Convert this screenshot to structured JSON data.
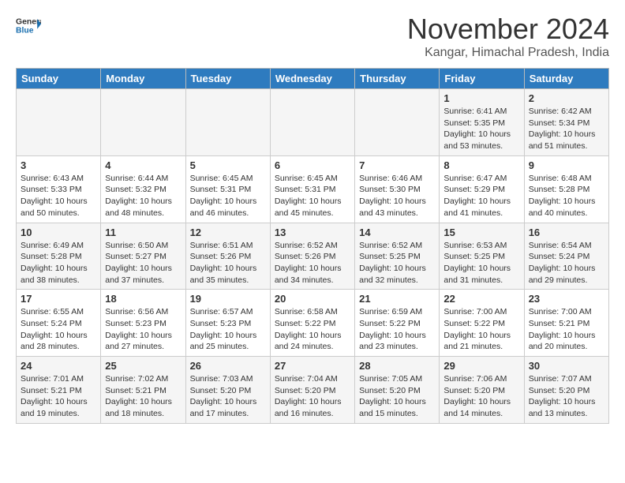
{
  "header": {
    "logo_general": "General",
    "logo_blue": "Blue",
    "month_title": "November 2024",
    "location": "Kangar, Himachal Pradesh, India"
  },
  "columns": [
    "Sunday",
    "Monday",
    "Tuesday",
    "Wednesday",
    "Thursday",
    "Friday",
    "Saturday"
  ],
  "weeks": [
    [
      {
        "day": "",
        "info": ""
      },
      {
        "day": "",
        "info": ""
      },
      {
        "day": "",
        "info": ""
      },
      {
        "day": "",
        "info": ""
      },
      {
        "day": "",
        "info": ""
      },
      {
        "day": "1",
        "info": "Sunrise: 6:41 AM\nSunset: 5:35 PM\nDaylight: 10 hours and 53 minutes."
      },
      {
        "day": "2",
        "info": "Sunrise: 6:42 AM\nSunset: 5:34 PM\nDaylight: 10 hours and 51 minutes."
      }
    ],
    [
      {
        "day": "3",
        "info": "Sunrise: 6:43 AM\nSunset: 5:33 PM\nDaylight: 10 hours and 50 minutes."
      },
      {
        "day": "4",
        "info": "Sunrise: 6:44 AM\nSunset: 5:32 PM\nDaylight: 10 hours and 48 minutes."
      },
      {
        "day": "5",
        "info": "Sunrise: 6:45 AM\nSunset: 5:31 PM\nDaylight: 10 hours and 46 minutes."
      },
      {
        "day": "6",
        "info": "Sunrise: 6:45 AM\nSunset: 5:31 PM\nDaylight: 10 hours and 45 minutes."
      },
      {
        "day": "7",
        "info": "Sunrise: 6:46 AM\nSunset: 5:30 PM\nDaylight: 10 hours and 43 minutes."
      },
      {
        "day": "8",
        "info": "Sunrise: 6:47 AM\nSunset: 5:29 PM\nDaylight: 10 hours and 41 minutes."
      },
      {
        "day": "9",
        "info": "Sunrise: 6:48 AM\nSunset: 5:28 PM\nDaylight: 10 hours and 40 minutes."
      }
    ],
    [
      {
        "day": "10",
        "info": "Sunrise: 6:49 AM\nSunset: 5:28 PM\nDaylight: 10 hours and 38 minutes."
      },
      {
        "day": "11",
        "info": "Sunrise: 6:50 AM\nSunset: 5:27 PM\nDaylight: 10 hours and 37 minutes."
      },
      {
        "day": "12",
        "info": "Sunrise: 6:51 AM\nSunset: 5:26 PM\nDaylight: 10 hours and 35 minutes."
      },
      {
        "day": "13",
        "info": "Sunrise: 6:52 AM\nSunset: 5:26 PM\nDaylight: 10 hours and 34 minutes."
      },
      {
        "day": "14",
        "info": "Sunrise: 6:52 AM\nSunset: 5:25 PM\nDaylight: 10 hours and 32 minutes."
      },
      {
        "day": "15",
        "info": "Sunrise: 6:53 AM\nSunset: 5:25 PM\nDaylight: 10 hours and 31 minutes."
      },
      {
        "day": "16",
        "info": "Sunrise: 6:54 AM\nSunset: 5:24 PM\nDaylight: 10 hours and 29 minutes."
      }
    ],
    [
      {
        "day": "17",
        "info": "Sunrise: 6:55 AM\nSunset: 5:24 PM\nDaylight: 10 hours and 28 minutes."
      },
      {
        "day": "18",
        "info": "Sunrise: 6:56 AM\nSunset: 5:23 PM\nDaylight: 10 hours and 27 minutes."
      },
      {
        "day": "19",
        "info": "Sunrise: 6:57 AM\nSunset: 5:23 PM\nDaylight: 10 hours and 25 minutes."
      },
      {
        "day": "20",
        "info": "Sunrise: 6:58 AM\nSunset: 5:22 PM\nDaylight: 10 hours and 24 minutes."
      },
      {
        "day": "21",
        "info": "Sunrise: 6:59 AM\nSunset: 5:22 PM\nDaylight: 10 hours and 23 minutes."
      },
      {
        "day": "22",
        "info": "Sunrise: 7:00 AM\nSunset: 5:22 PM\nDaylight: 10 hours and 21 minutes."
      },
      {
        "day": "23",
        "info": "Sunrise: 7:00 AM\nSunset: 5:21 PM\nDaylight: 10 hours and 20 minutes."
      }
    ],
    [
      {
        "day": "24",
        "info": "Sunrise: 7:01 AM\nSunset: 5:21 PM\nDaylight: 10 hours and 19 minutes."
      },
      {
        "day": "25",
        "info": "Sunrise: 7:02 AM\nSunset: 5:21 PM\nDaylight: 10 hours and 18 minutes."
      },
      {
        "day": "26",
        "info": "Sunrise: 7:03 AM\nSunset: 5:20 PM\nDaylight: 10 hours and 17 minutes."
      },
      {
        "day": "27",
        "info": "Sunrise: 7:04 AM\nSunset: 5:20 PM\nDaylight: 10 hours and 16 minutes."
      },
      {
        "day": "28",
        "info": "Sunrise: 7:05 AM\nSunset: 5:20 PM\nDaylight: 10 hours and 15 minutes."
      },
      {
        "day": "29",
        "info": "Sunrise: 7:06 AM\nSunset: 5:20 PM\nDaylight: 10 hours and 14 minutes."
      },
      {
        "day": "30",
        "info": "Sunrise: 7:07 AM\nSunset: 5:20 PM\nDaylight: 10 hours and 13 minutes."
      }
    ]
  ]
}
